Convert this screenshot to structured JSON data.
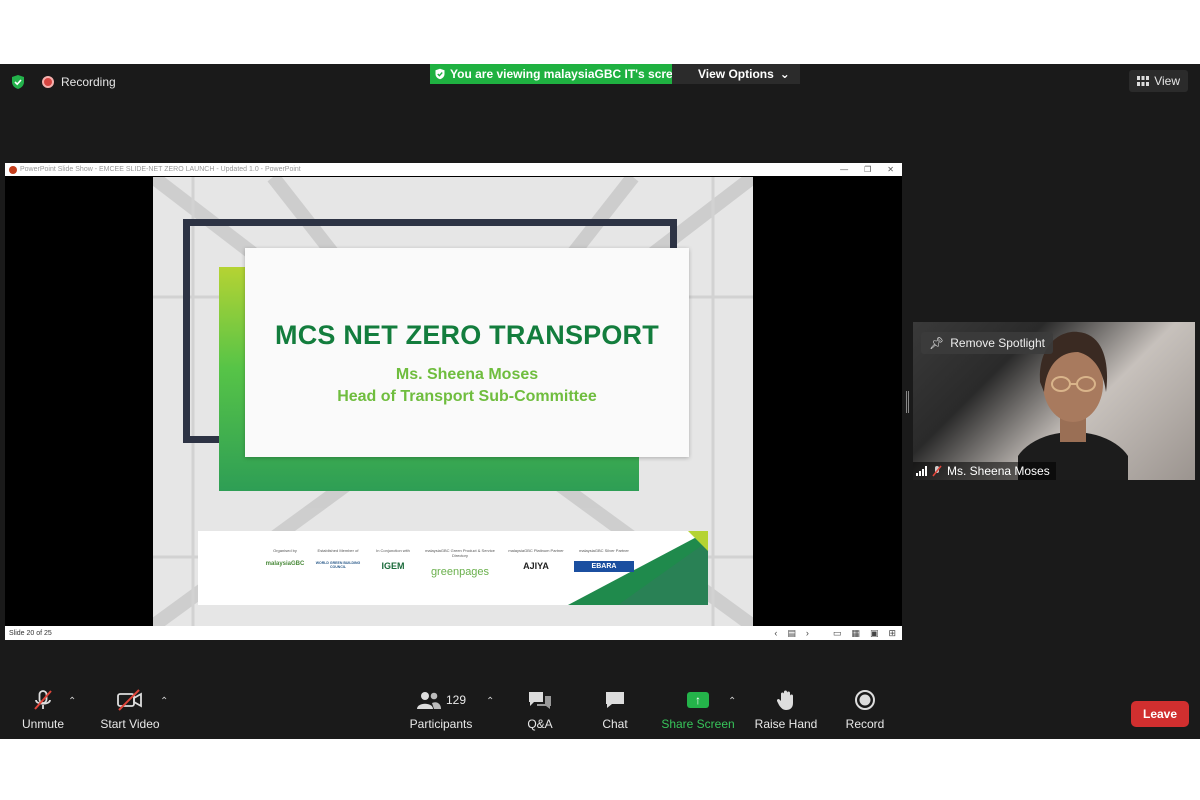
{
  "top_bar": {
    "recording_label": "Recording",
    "viewing_banner": "You are viewing malaysiaGBC IT's screen",
    "view_options_label": "View Options",
    "view_label": "View"
  },
  "shared_screen": {
    "window_title": "PowerPoint Slide Show - EMCEE SLIDE-NET ZERO LAUNCH - Updated 1.0 - PowerPoint",
    "slide_status": "Slide 20 of 25",
    "slide": {
      "title": "MCS NET ZERO TRANSPORT",
      "name": "Ms. Sheena Moses",
      "role": "Head of Transport Sub-Committee",
      "sponsors": [
        {
          "caption": "Organised by",
          "logo": "malaysiaGBC"
        },
        {
          "caption": "Established Member of",
          "logo": "WORLD GREEN BUILDING COUNCIL"
        },
        {
          "caption": "In Conjunction with",
          "logo": "IGEM"
        },
        {
          "caption": "malaysiaGBC Green Product & Service Directory",
          "logo": "greenpages"
        },
        {
          "caption": "malaysiaGBC Platinum Partner",
          "logo": "AJIYA"
        },
        {
          "caption": "malaysiaGBC Silver Partner",
          "logo": "EBARA"
        }
      ]
    }
  },
  "video_tile": {
    "remove_spotlight_label": "Remove Spotlight",
    "participant_name": "Ms. Sheena Moses"
  },
  "toolbar": {
    "unmute_label": "Unmute",
    "start_video_label": "Start Video",
    "participants_label": "Participants",
    "participants_count": "129",
    "qa_label": "Q&A",
    "chat_label": "Chat",
    "share_screen_label": "Share Screen",
    "raise_hand_label": "Raise Hand",
    "record_label": "Record",
    "leave_label": "Leave"
  },
  "colors": {
    "banner_green": "#1fb141",
    "slide_title_green": "#137d3d",
    "slide_sub_green": "#6fbd3e",
    "leave_red": "#d12f2f"
  }
}
